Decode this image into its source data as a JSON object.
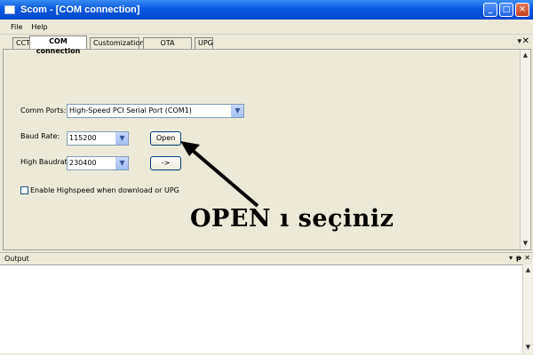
{
  "window": {
    "title": "Scom - [COM connection]",
    "buttons": {
      "minimize": "_",
      "maximize": "□",
      "close": "✕"
    }
  },
  "menu": {
    "items": [
      "File",
      "Help"
    ]
  },
  "tabs": [
    {
      "label": "CCT",
      "active": false
    },
    {
      "label": "COM connection",
      "active": true
    },
    {
      "label": "Customization",
      "active": false
    },
    {
      "label": "OTA Streamer",
      "active": false
    },
    {
      "label": "UPG",
      "active": false
    }
  ],
  "tab_controls": {
    "dropdown": "▾",
    "close": "✕"
  },
  "form": {
    "comm_ports_label": "Comm Ports:",
    "comm_ports_value": "High-Speed PCI Serial Port (COM1)",
    "baud_rate_label": "Baud Rate:",
    "baud_rate_value": "115200",
    "high_baudrate_label": "High Baudrate:",
    "high_baudrate_value": "230400",
    "open_button": "Open",
    "arrow_button": "->",
    "highspeed_checkbox_label": "Enable Highspeed when download or UPG",
    "highspeed_checked": false
  },
  "annotation": {
    "text": "OPEN ı seçiniz"
  },
  "output": {
    "title": "Output",
    "controls": {
      "dropdown": "▾",
      "pin": "ᵽ",
      "close": "✕"
    }
  },
  "colors": {
    "titlebar": "#0a58e0",
    "panel": "#ece9d8",
    "arrow": "#000000"
  }
}
